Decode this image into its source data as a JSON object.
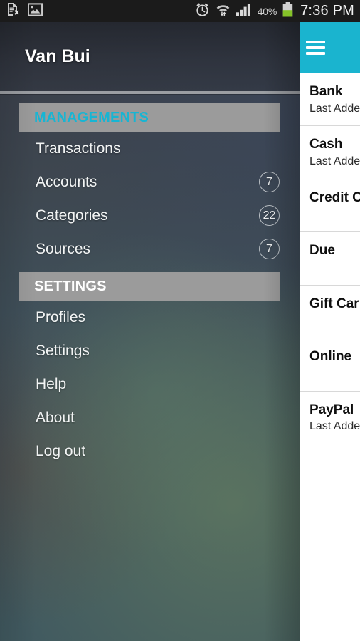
{
  "status_bar": {
    "left_icons": [
      "sim-card-error-icon",
      "image-icon"
    ],
    "right_icons": [
      "alarm-clock-icon",
      "wifi-data-transfer-icon",
      "signal-bars-icon",
      "battery-icon"
    ],
    "battery_percent": "40%",
    "clock": "7:36 PM"
  },
  "drawer": {
    "user_name": "Van Bui",
    "sections": [
      {
        "header": "MANAGEMENTS",
        "header_color": "#17b5d3",
        "items": [
          {
            "label": "Transactions",
            "badge": ""
          },
          {
            "label": "Accounts",
            "badge": "7"
          },
          {
            "label": "Categories",
            "badge": "22"
          },
          {
            "label": "Sources",
            "badge": "7"
          }
        ]
      },
      {
        "header": "SETTINGS",
        "header_color": "#ffffff",
        "items": [
          {
            "label": "Profiles",
            "badge": ""
          },
          {
            "label": "Settings",
            "badge": ""
          },
          {
            "label": "Help",
            "badge": ""
          },
          {
            "label": "About",
            "badge": ""
          },
          {
            "label": "Log out",
            "badge": ""
          }
        ]
      }
    ]
  },
  "content": {
    "appbar": {
      "menu_icon": "hamburger-menu-icon",
      "accent_color": "#1ab4cf"
    },
    "list": [
      {
        "title": "Bank",
        "subtitle": "Last Adde"
      },
      {
        "title": "Cash",
        "subtitle": "Last Adde"
      },
      {
        "title": "Credit C",
        "subtitle": ""
      },
      {
        "title": "Due",
        "subtitle": ""
      },
      {
        "title": "Gift Car",
        "subtitle": ""
      },
      {
        "title": "Online",
        "subtitle": ""
      },
      {
        "title": "PayPal",
        "subtitle": "Last Adde"
      }
    ]
  }
}
